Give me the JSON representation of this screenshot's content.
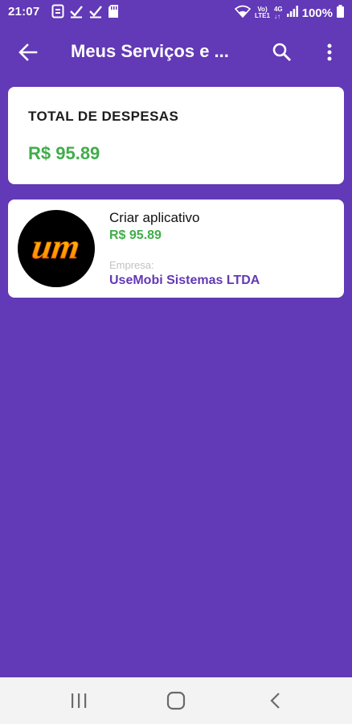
{
  "status_bar": {
    "time": "21:07",
    "battery_text": "100%",
    "left_icons": [
      "screen-record-icon",
      "check-icon",
      "check-icon",
      "sd-card-icon"
    ],
    "right_icons": [
      "wifi-icon",
      "volte-icon",
      "signal-4g-icon",
      "signal-bars-icon",
      "battery-icon"
    ]
  },
  "app_bar": {
    "title": "Meus Serviços e ...",
    "back_icon": "arrow-back-icon",
    "search_icon": "search-icon",
    "menu_icon": "more-vert-icon"
  },
  "total_card": {
    "label": "TOTAL DE DESPESAS",
    "value": "R$ 95.89"
  },
  "services": [
    {
      "name": "Criar aplicativo",
      "price": "R$ 95.89",
      "company_label": "Empresa:",
      "company": "UseMobi Sistemas LTDA",
      "logo_text": "um"
    }
  ],
  "nav_bar": {
    "icons": [
      "recent-apps-icon",
      "home-icon",
      "back-icon"
    ]
  },
  "colors": {
    "background": "#6239b6",
    "price_green": "#3fae49",
    "company_purple": "#6239b6",
    "logo_orange": "#f5a300"
  }
}
